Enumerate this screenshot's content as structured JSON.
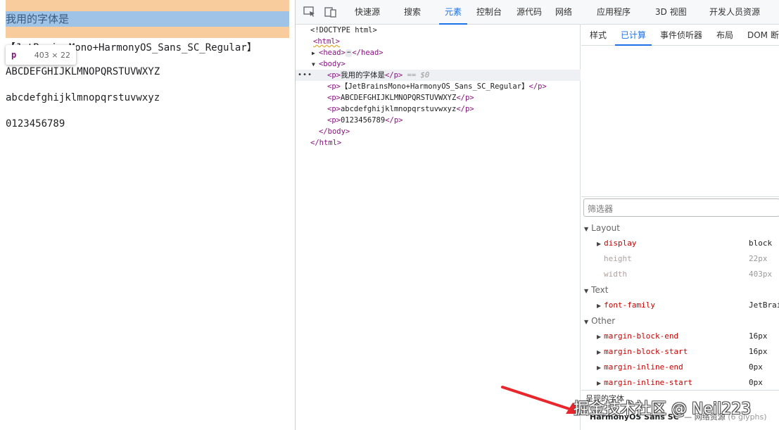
{
  "preview": {
    "line1": "我用的字体是",
    "line2": "【JetBrainsMono+HarmonyOS_Sans_SC_Regular】",
    "line3": "ABCDEFGHIJKLMNOPQRSTUVWXYZ",
    "line4": "abcdefghijklmnopqrstuvwxyz",
    "line5": "0123456789",
    "tooltip_tag": "p",
    "tooltip_dims": "403 × 22"
  },
  "toolbar": {
    "inspect_icon": "inspect-icon",
    "device_icon": "device-toggle-icon",
    "tabs": [
      "快速源",
      "搜索",
      "元素",
      "控制台",
      "源代码",
      "网络",
      "应用程序",
      "3D 视图",
      "开发人员资源"
    ],
    "active_tab": "元素"
  },
  "dom_tree": {
    "doctype": "<!DOCTYPE html>",
    "html_open": "<html>",
    "head_open": "<head>",
    "head_close": "</head>",
    "body_open": "<body>",
    "p1_text": "我用的字体是",
    "p1_marker": "== $0",
    "p2_text": "【JetBrainsMono+HarmonyOS_Sans_SC_Regular】",
    "p3_text": "ABCDEFGHIJKLMNOPQRSTUVWXYZ",
    "p4_text": "abcdefghijklmnopqrstuvwxyz",
    "p5_text": "0123456789",
    "body_close": "</body>",
    "html_close": "</html>",
    "p_open": "<p>",
    "p_close": "</p>",
    "selected_dots": "•••",
    "ellipsis": "⋯"
  },
  "side_panel": {
    "subtabs": [
      "样式",
      "已计算",
      "事件侦听器",
      "布局",
      "DOM 断点"
    ],
    "active_subtab": "已计算",
    "filter_placeholder": "筛选器",
    "groups": {
      "layout": "Layout",
      "text": "Text",
      "other": "Other"
    },
    "properties": {
      "display": {
        "name": "display",
        "value": "block"
      },
      "height": {
        "name": "height",
        "value": "22px"
      },
      "width": {
        "name": "width",
        "value": "403px"
      },
      "font_family": {
        "name": "font-family",
        "value": "JetBrains"
      },
      "margin_block_end": {
        "name": "margin-block-end",
        "value": "16px"
      },
      "margin_block_start": {
        "name": "margin-block-start",
        "value": "16px"
      },
      "margin_inline_end": {
        "name": "margin-inline-end",
        "value": "0px"
      },
      "margin_inline_start": {
        "name": "margin-inline-start",
        "value": "0px"
      }
    },
    "rendered_fonts": {
      "title": "呈现的字体",
      "font_name": "HarmonyOS Sans SC",
      "source": "— 网络资源",
      "count": "(6 glyphs)"
    }
  },
  "watermark": "掘金技术社区 @ Neil223",
  "colors": {
    "accent": "#1a73e8",
    "tag": "#881280",
    "prop_name": "#c80000",
    "highlight_margin": "#f9cc9d",
    "highlight_content": "#9fc3e6",
    "arrow": "#e8262b"
  }
}
